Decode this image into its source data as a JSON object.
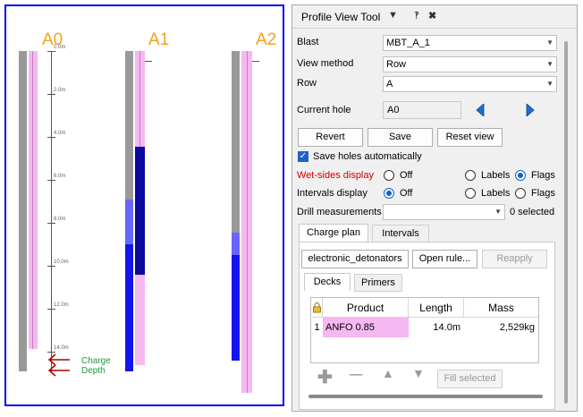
{
  "profile": {
    "holes": [
      {
        "label": "A0"
      },
      {
        "label": "A1"
      },
      {
        "label": "A2"
      }
    ],
    "depth_ticks": [
      "0.0m",
      "2.0m",
      "4.0m",
      "6.0m",
      "8.0m",
      "10.0m",
      "12.0m",
      "14.0m"
    ],
    "charge_depth_label_1": "Charge",
    "charge_depth_label_2": "Depth",
    "colors": {
      "frame": "#0000ff",
      "hole_label": "#f7a01c",
      "hole_gray": "#999999",
      "pink": "#f5b8f0",
      "deck_dark": "#0a0aa0",
      "deck_blue": "#1414ee",
      "deck_mid": "#6666ff",
      "charge_arrow": "#b00000",
      "charge_text": "#1f9a3a"
    }
  },
  "panel": {
    "title": "Profile View Tool",
    "icons": {
      "menu": "chevron-down-icon",
      "pin": "pin-icon",
      "close": "close-icon"
    },
    "blast": {
      "label": "Blast",
      "value": "MBT_A_1"
    },
    "view_method": {
      "label": "View method",
      "value": "Row"
    },
    "row": {
      "label": "Row",
      "value": "A"
    },
    "current_hole": {
      "label": "Current hole",
      "value": "A0"
    },
    "buttons": {
      "revert": "Revert",
      "save": "Save",
      "reset_view": "Reset view"
    },
    "save_auto": {
      "label": "Save holes automatically",
      "checked": true
    },
    "wet_sides": {
      "label": "Wet-sides display",
      "off": "Off",
      "labels": "Labels",
      "flags": "Flags",
      "selected": "Flags"
    },
    "intervals_display": {
      "label": "Intervals display",
      "off": "Off",
      "labels": "Labels",
      "flags": "Flags",
      "selected": "Off"
    },
    "drill_measurements": {
      "label": "Drill measurements",
      "value": "",
      "count": "0 selected"
    },
    "tabs": {
      "charge_plan": "Charge plan",
      "intervals": "Intervals",
      "active": "Charge plan"
    },
    "rule": {
      "name": "electronic_detonators",
      "open": "Open rule...",
      "reapply": "Reapply"
    },
    "subtabs": {
      "decks": "Decks",
      "primers": "Primers",
      "active": "Decks"
    },
    "table": {
      "headers": [
        "Product",
        "Length",
        "Mass"
      ],
      "rows": [
        {
          "index": "1",
          "product": "ANFO 0.85",
          "length": "14.0m",
          "mass": "2,529kg"
        }
      ]
    },
    "fill_selected": "Fill selected"
  }
}
